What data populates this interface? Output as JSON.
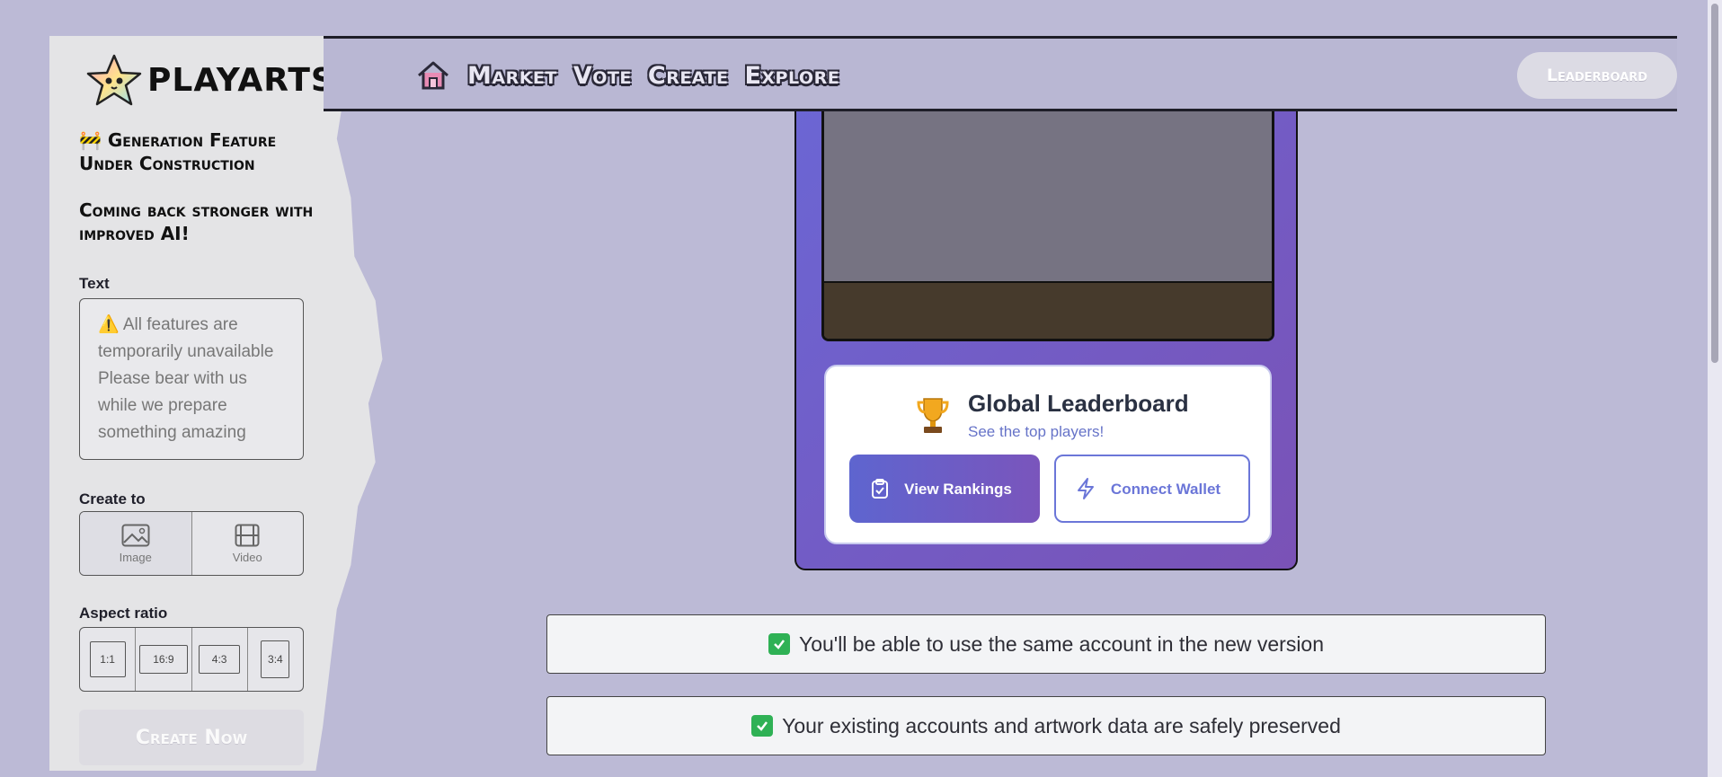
{
  "app": {
    "logo_text": "PLAYARTS"
  },
  "nav": {
    "items": [
      "Market",
      "Vote",
      "Create",
      "Explore"
    ],
    "leaderboard_label": "Leaderboard"
  },
  "sidebar": {
    "notice_line1": "🚧 Generation Feature Under Construction",
    "notice_line2": "Coming back stronger with improved AI!",
    "text_label": "Text",
    "text_value": "⚠️ All features are temporarily unavailable Please bear with us while we prepare something amazing",
    "create_to_label": "Create to",
    "create_to_options": [
      "Image",
      "Video"
    ],
    "aspect_label": "Aspect ratio",
    "aspect_options": [
      "1:1",
      "16:9",
      "4:3",
      "3:4"
    ],
    "create_button": "Create Now"
  },
  "card": {
    "leaderboard_title": "Global Leaderboard",
    "leaderboard_sub": "See the top players!",
    "view_rankings": "View Rankings",
    "connect_wallet": "Connect Wallet"
  },
  "notices": [
    "You'll be able to use the same account in the new version",
    "Your existing accounts and artwork data are safely preserved"
  ],
  "colors": {
    "background": "#bcbad6",
    "accent": "#6b66d4",
    "check": "#2fb155"
  }
}
